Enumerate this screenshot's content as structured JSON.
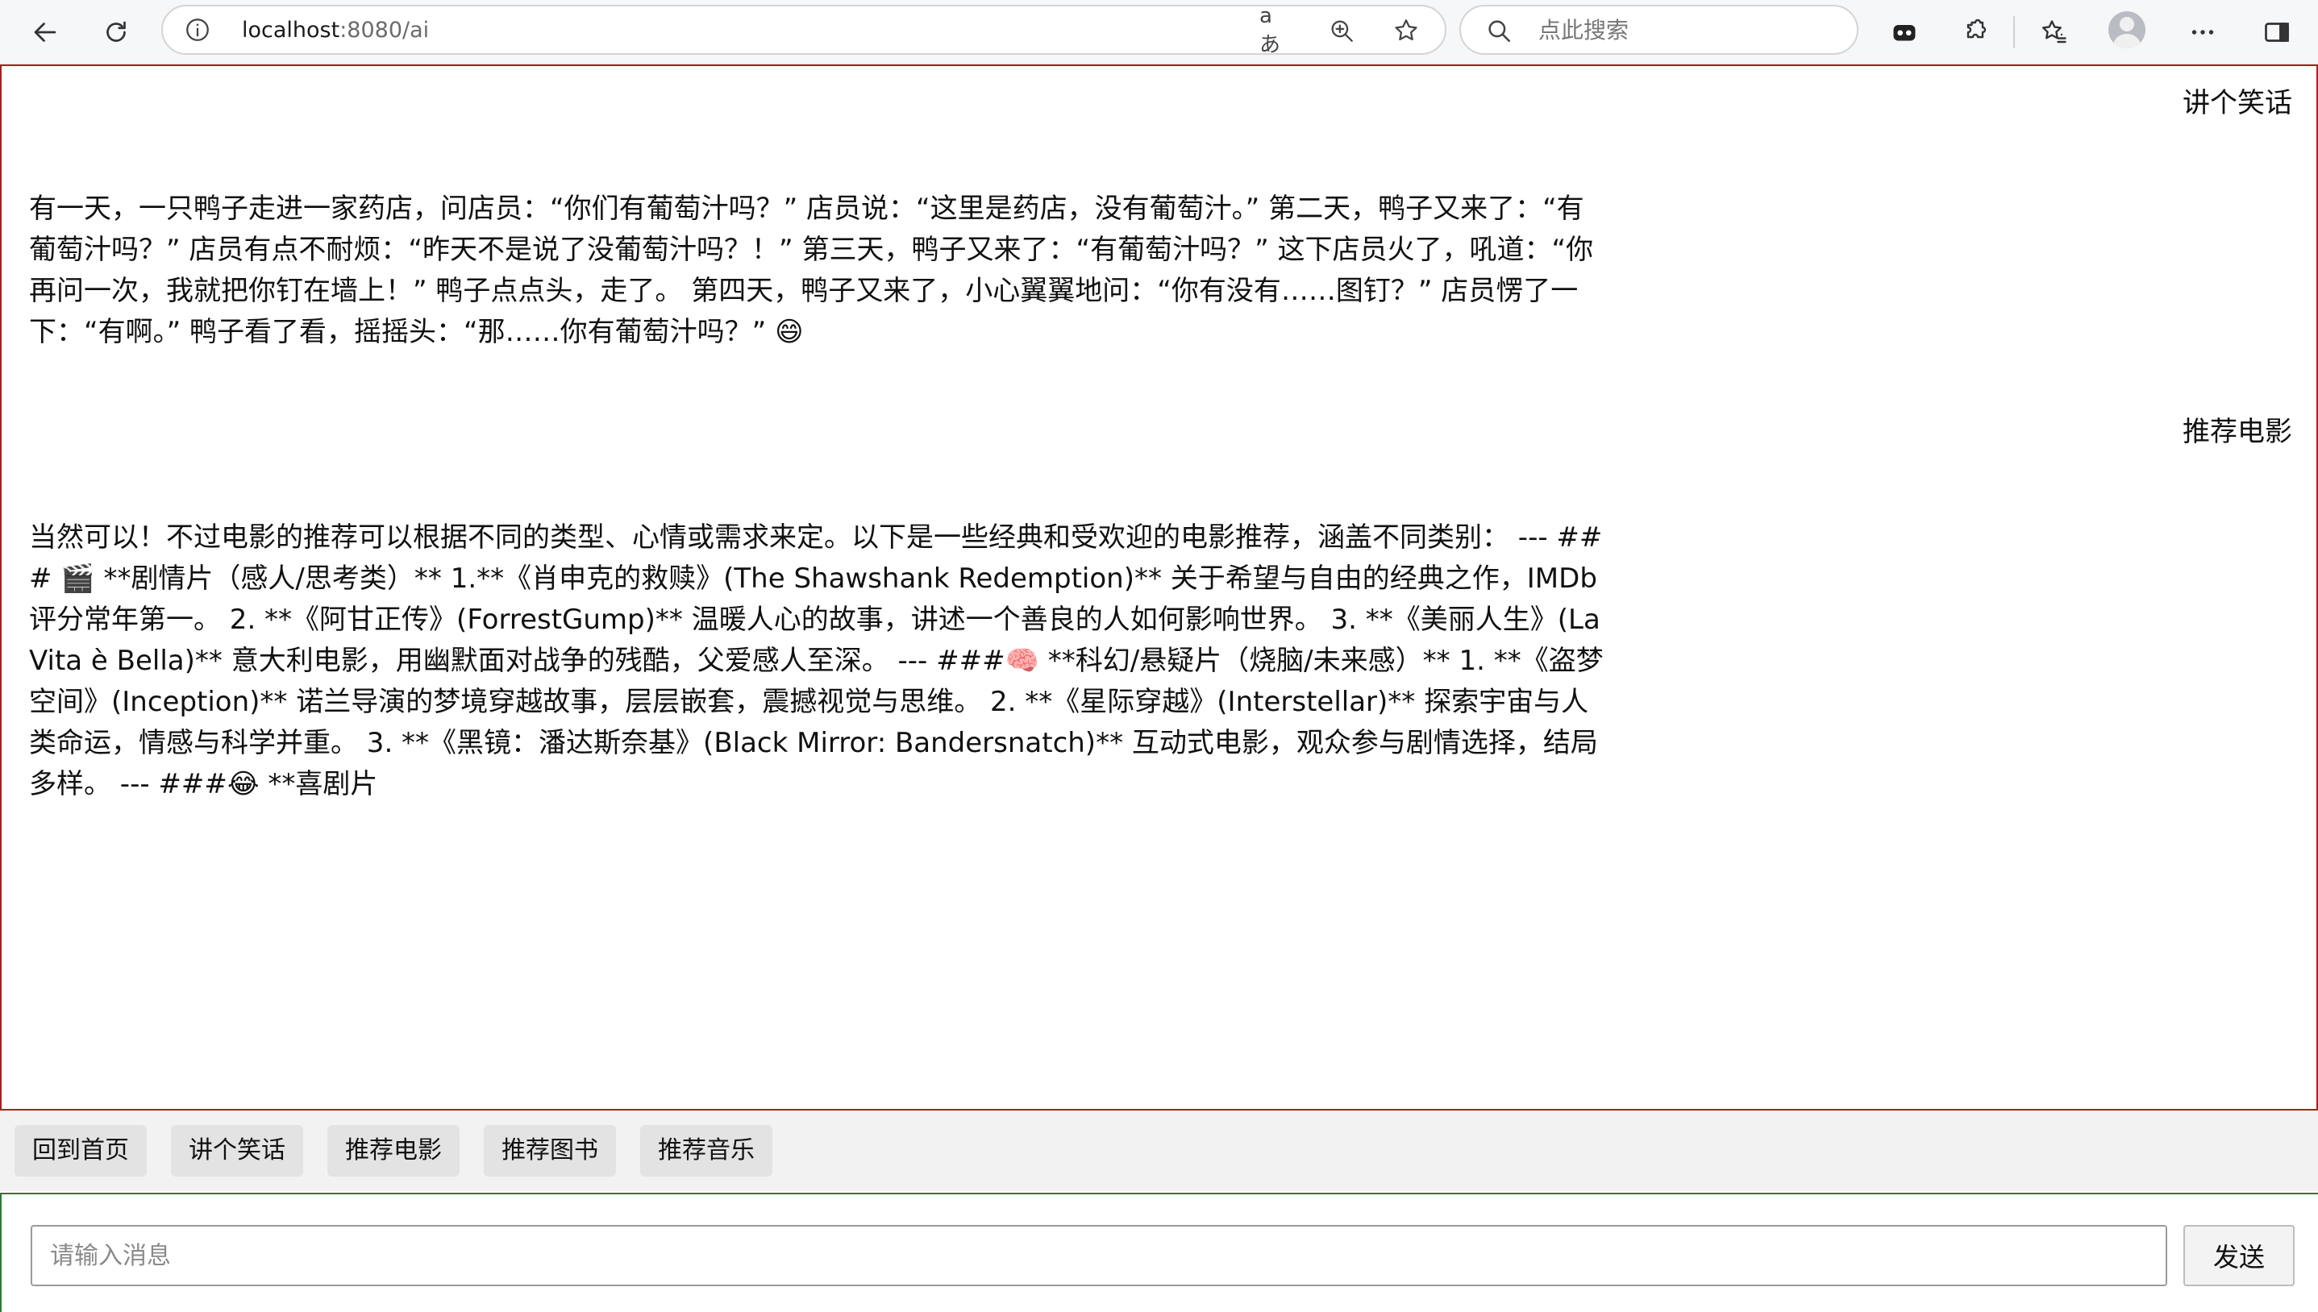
{
  "browser": {
    "url_host": "localhost",
    "url_path": ":8080/ai",
    "read_aloud_label": "aあ",
    "search_placeholder": "点此搜索",
    "icons": [
      "back-arrow-icon",
      "refresh-icon",
      "info-icon",
      "read-aloud-icon",
      "zoom-icon",
      "star-icon",
      "search-icon",
      "copilot-icon",
      "extensions-icon",
      "favorites-icon",
      "profile-avatar",
      "more-icon",
      "sidebar-icon"
    ]
  },
  "chat": {
    "messages": [
      {
        "role": "user",
        "text": "讲个笑话"
      },
      {
        "role": "ai",
        "text": "有一天，一只鸭子走进一家药店，问店员：“你们有葡萄汁吗？” 店员说：“这里是药店，没有葡萄汁。” 第二天，鸭子又来了：“有葡萄汁吗？” 店员有点不耐烦：“昨天不是说了没葡萄汁吗？！” 第三天，鸭子又来了：“有葡萄汁吗？” 这下店员火了，吼道：“你再问一次，我就把你钉在墙上！” 鸭子点点头，走了。 第四天，鸭子又来了，小心翼翼地问：“你有没有……图钉？” 店员愣了一下：“有啊。” 鸭子看了看，摇摇头：“那……你有葡萄汁吗？” 😄"
      },
      {
        "role": "user",
        "text": "推荐电影"
      },
      {
        "role": "ai",
        "text": "当然可以！不过电影的推荐可以根据不同的类型、心情或需求来定。以下是一些经典和受欢迎的电影推荐，涵盖不同类别： --- ### 🎬 **剧情片（感人/思考类）** 1.**《肖申克的救赎》(The Shawshank Redemption)** 关于希望与自由的经典之作，IMDb评分常年第一。 2. **《阿甘正传》(ForrestGump)** 温暖人心的故事，讲述一个善良的人如何影响世界。 3. **《美丽人生》(LaVita è Bella)** 意大利电影，用幽默面对战争的残酷，父爱感人至深。 --- ###🧠 **科幻/悬疑片（烧脑/未来感）** 1. **《盗梦空间》(Inception)** 诺兰导演的梦境穿越故事，层层嵌套，震撼视觉与思维。 2. **《星际穿越》(Interstellar)** 探索宇宙与人类命运，情感与科学并重。 3. **《黑镜：潘达斯奈基》(Black Mirror: Bandersnatch)** 互动式电影，观众参与剧情选择，结局多样。 --- ###😂 **喜剧片"
      }
    ]
  },
  "quick_buttons": {
    "home": "回到首页",
    "joke": "讲个笑话",
    "movie": "推荐电影",
    "book": "推荐图书",
    "music": "推荐音乐"
  },
  "input": {
    "placeholder": "请输入消息",
    "value": "",
    "send_label": "发送"
  },
  "colors": {
    "chat_border": "#b01c1c",
    "input_border": "#2d7a2d",
    "quick_bar_bg": "#f2f2f2",
    "quick_button_bg": "#e3e3e3"
  }
}
